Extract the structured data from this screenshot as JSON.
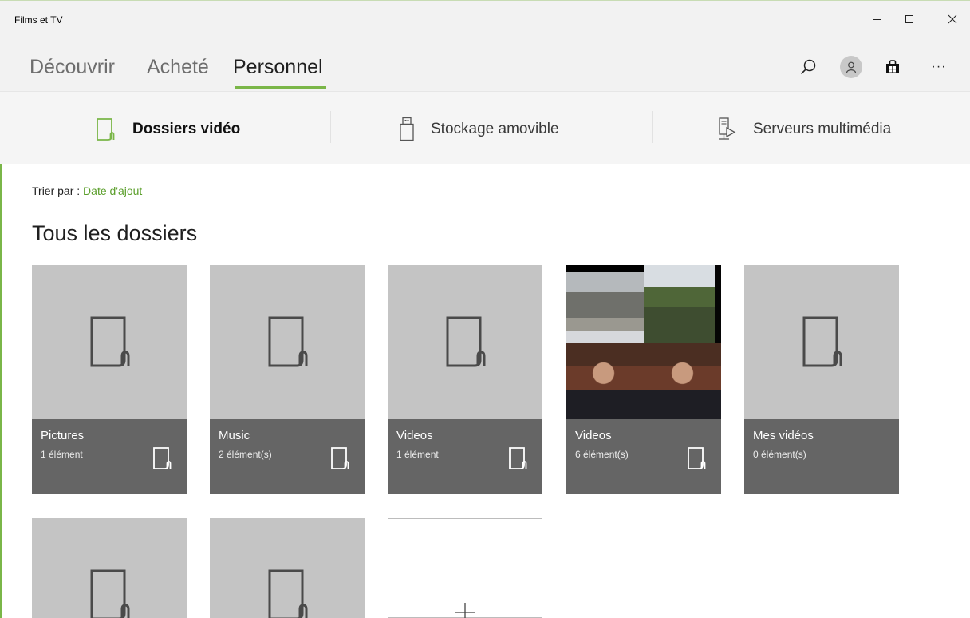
{
  "app": {
    "title": "Films et TV"
  },
  "window_controls": {
    "minimize": "–",
    "maximize": "☐",
    "close": "✕"
  },
  "nav": {
    "tabs": [
      {
        "label": "Découvrir",
        "active": false
      },
      {
        "label": "Acheté",
        "active": false
      },
      {
        "label": "Personnel",
        "active": true
      }
    ],
    "icons": [
      "search-icon",
      "account-icon",
      "store-icon",
      "more-icon"
    ],
    "more_label": "···"
  },
  "subnav": {
    "items": [
      {
        "label": "Dossiers vidéo",
        "icon": "folder-icon",
        "active": true
      },
      {
        "label": "Stockage amovible",
        "icon": "usb-drive-icon",
        "active": false
      },
      {
        "label": "Serveurs multimédia",
        "icon": "media-server-icon",
        "active": false
      }
    ]
  },
  "sort": {
    "label": "Trier par :",
    "value": "Date d'ajout"
  },
  "section": {
    "title": "Tous les dossiers"
  },
  "folders": [
    {
      "name": "Pictures",
      "count": "1 élément"
    },
    {
      "name": "Music",
      "count": "2 élément(s)"
    },
    {
      "name": "Videos",
      "count": "1 élément"
    },
    {
      "name": "Videos",
      "count": "6 élément(s)",
      "has_thumbnails": true
    },
    {
      "name": "Mes vidéos",
      "count": "0 élément(s)"
    }
  ],
  "add_tile": {
    "icon": "plus-icon"
  },
  "colors": {
    "accent": "#7ab648",
    "link": "#5a9e2a",
    "tile_bg": "#c4c4c4",
    "tile_info": "#656565",
    "chrome": "#f2f2f2"
  }
}
